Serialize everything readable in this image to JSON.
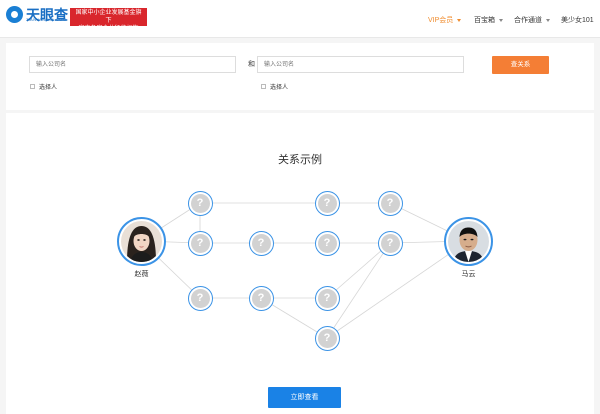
{
  "header": {
    "logo_text": "天眼查",
    "logo_sub": "TIANYANCHA.COM",
    "slogan_line1": "国家中小企业发展基金旗下",
    "slogan_line2": "官方备案企业征信机构",
    "nav": [
      {
        "label": "VIP会员"
      },
      {
        "label": "百宝箱"
      },
      {
        "label": "合作通道"
      },
      {
        "label": "美少女101"
      }
    ]
  },
  "search": {
    "placeholder1": "输入公司名",
    "and_label": "和",
    "placeholder2": "输入公司名",
    "button_label": "查关系",
    "check1_label": "选择人",
    "check2_label": "选择人"
  },
  "graph": {
    "title": "关系示例",
    "unknown_glyph": "?",
    "person_left": "赵薇",
    "person_right": "马云",
    "button_label": "立即查看"
  },
  "colors": {
    "accent_orange": "#f47e35",
    "primary_blue": "#1a82e6",
    "node_border": "#3b93e6",
    "brand_red": "#d9262c"
  }
}
